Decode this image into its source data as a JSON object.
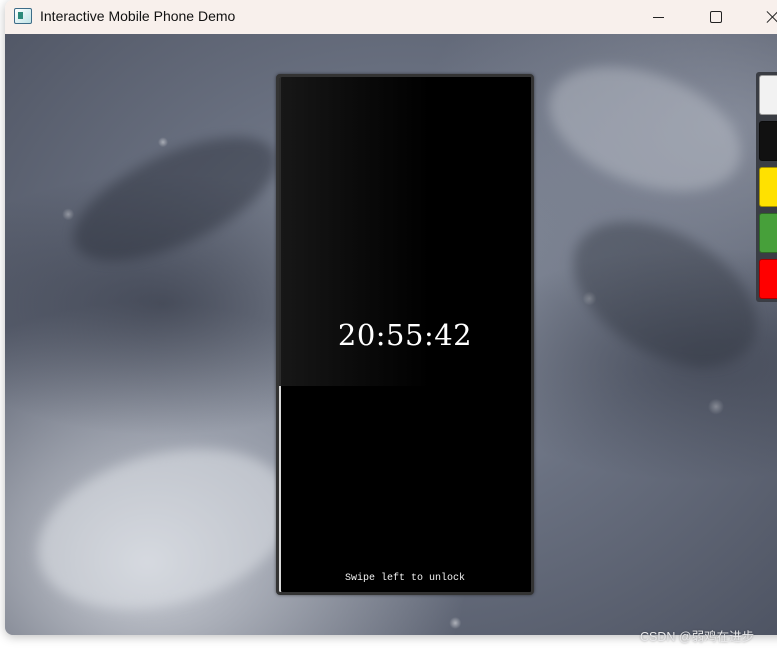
{
  "window": {
    "title": "Interactive Mobile Phone Demo",
    "icon": "app-window-icon",
    "controls": [
      "minimize-icon",
      "maximize-icon",
      "close-icon"
    ]
  },
  "phone": {
    "clock": "20:55:42",
    "unlock_hint": "Swipe left to unlock",
    "screen_color": "#000000",
    "frame_color": "#333333"
  },
  "color_palette": {
    "swatches": [
      {
        "name": "white",
        "color": "#f2f2f2"
      },
      {
        "name": "black",
        "color": "#111111"
      },
      {
        "name": "yellow",
        "color": "#ffe100"
      },
      {
        "name": "green",
        "color": "#47a03a"
      },
      {
        "name": "red",
        "color": "#ff0000"
      }
    ]
  },
  "watermark": "CSDN @弱鸡在进步"
}
